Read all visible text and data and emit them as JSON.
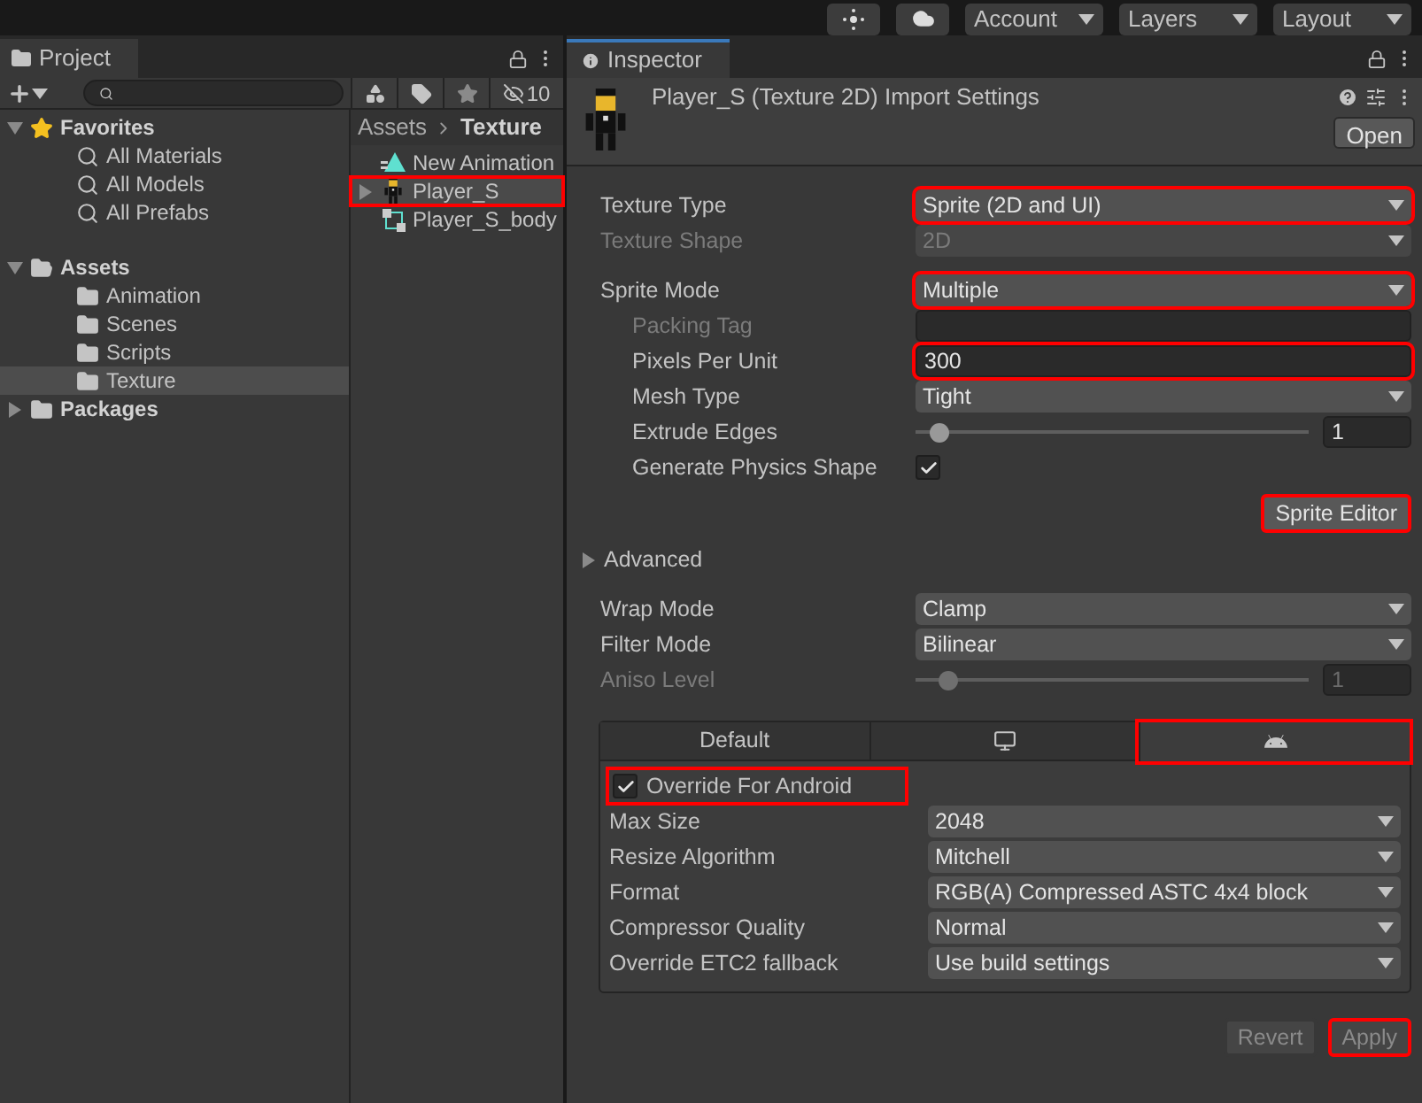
{
  "toolbar": {
    "dropdowns": [
      "Account",
      "Layers",
      "Layout"
    ]
  },
  "project": {
    "title": "Project",
    "hidden_count": "10",
    "tree": [
      {
        "label": "Favorites",
        "kind": "favorites",
        "expanded": true,
        "children": [
          {
            "label": "All Materials",
            "kind": "search"
          },
          {
            "label": "All Models",
            "kind": "search"
          },
          {
            "label": "All Prefabs",
            "kind": "search"
          }
        ]
      },
      {
        "label": "Assets",
        "kind": "folder",
        "expanded": true,
        "children": [
          {
            "label": "Animation",
            "kind": "folder",
            "selected": false
          },
          {
            "label": "Scenes",
            "kind": "folder",
            "selected": false
          },
          {
            "label": "Scripts",
            "kind": "folder",
            "selected": false
          },
          {
            "label": "Texture",
            "kind": "folder",
            "selected": true
          }
        ]
      },
      {
        "label": "Packages",
        "kind": "folder",
        "expanded": false
      }
    ],
    "breadcrumb": [
      "Assets",
      "Texture"
    ],
    "files": [
      {
        "name": "New Animation",
        "kind": "animation",
        "highlighted": false
      },
      {
        "name": "Player_S",
        "kind": "sprite",
        "highlighted": true
      },
      {
        "name": "Player_S_body",
        "kind": "prefab",
        "highlighted": false
      }
    ]
  },
  "inspector": {
    "title": "Inspector",
    "asset_title": "Player_S (Texture 2D) Import Settings",
    "open_button": "Open",
    "fields": [
      {
        "label": "Texture Type",
        "kind": "dropdown",
        "value": "Sprite (2D and UI)",
        "disabled": false,
        "highlighted": true
      },
      {
        "label": "Texture Shape",
        "kind": "dropdown",
        "value": "2D",
        "disabled": true,
        "highlighted": false
      },
      {
        "kind": "gap"
      },
      {
        "label": "Sprite Mode",
        "kind": "dropdown",
        "value": "Multiple",
        "disabled": false,
        "highlighted": true,
        "children": [
          {
            "label": "Packing Tag",
            "kind": "text",
            "disabled": true,
            "highlighted": false
          },
          {
            "label": "Pixels Per Unit",
            "kind": "text",
            "value": "300",
            "disabled": false,
            "highlighted": true
          },
          {
            "label": "Mesh Type",
            "kind": "dropdown",
            "value": "Tight",
            "disabled": false,
            "highlighted": false
          },
          {
            "label": "Extrude Edges",
            "kind": "slider",
            "level": 0.06,
            "value": "1",
            "disabled": false
          },
          {
            "label": "Generate Physics Shape",
            "kind": "checkbox",
            "checked": true,
            "disabled": false
          }
        ]
      }
    ],
    "sprite_editor": {
      "label": "Sprite Editor",
      "highlighted": true
    },
    "advanced": {
      "label": "Advanced",
      "expanded": false
    },
    "fields2": [
      {
        "label": "Wrap Mode",
        "kind": "dropdown",
        "value": "Clamp",
        "disabled": false,
        "highlighted": false
      },
      {
        "label": "Filter Mode",
        "kind": "dropdown",
        "value": "Bilinear",
        "disabled": false,
        "highlighted": false
      },
      {
        "label": "Aniso Level",
        "kind": "slider",
        "level": 0.08,
        "value": "1",
        "disabled": true
      }
    ],
    "platform_tabs": [
      {
        "kind": "text",
        "label": "Default",
        "selected": false,
        "highlighted": false
      },
      {
        "kind": "monitor",
        "selected": false,
        "highlighted": false
      },
      {
        "kind": "android",
        "selected": true,
        "highlighted": true
      }
    ],
    "override": {
      "label": "Override For Android",
      "checked": true,
      "highlighted": true
    },
    "platform_fields": [
      {
        "label": "Max Size",
        "kind": "dropdown",
        "value": "2048",
        "disabled": false,
        "highlighted": false
      },
      {
        "label": "Resize Algorithm",
        "kind": "dropdown",
        "value": "Mitchell",
        "disabled": false,
        "highlighted": false
      },
      {
        "label": "Format",
        "kind": "dropdown",
        "value": "RGB(A) Compressed ASTC 4x4 block",
        "disabled": false,
        "highlighted": false
      },
      {
        "label": "Compressor Quality",
        "kind": "dropdown",
        "value": "Normal",
        "disabled": false,
        "highlighted": false
      },
      {
        "label": "Override ETC2 fallback",
        "kind": "dropdown",
        "value": "Use build settings",
        "disabled": false,
        "highlighted": false
      }
    ],
    "buttons": [
      {
        "label": "Revert",
        "disabled": true,
        "highlighted": false
      },
      {
        "label": "Apply",
        "disabled": true,
        "highlighted": true
      }
    ]
  }
}
